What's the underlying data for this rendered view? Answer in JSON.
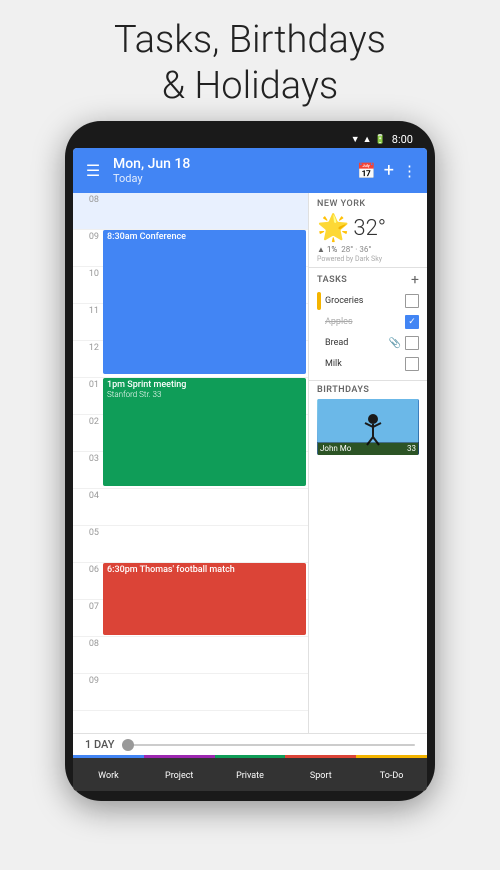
{
  "page": {
    "title_line1": "Tasks, Birthdays",
    "title_line2": "& Holidays"
  },
  "status_bar": {
    "time": "8:00"
  },
  "toolbar": {
    "date": "Mon, Jun 18",
    "subtitle": "Today",
    "menu_icon": "☰",
    "calendar_icon": "📅",
    "add_icon": "+",
    "more_icon": "⋮"
  },
  "calendar": {
    "slots": [
      {
        "hour": "08",
        "has_event": false,
        "shaded": true
      },
      {
        "hour": "09",
        "has_event": false,
        "shaded": false
      },
      {
        "hour": "10",
        "has_event": false,
        "shaded": false
      },
      {
        "hour": "11",
        "has_event": false,
        "shaded": false
      },
      {
        "hour": "12",
        "has_event": false,
        "shaded": false
      },
      {
        "hour": "01",
        "has_event": false,
        "shaded": false
      },
      {
        "hour": "02",
        "has_event": false,
        "shaded": false
      },
      {
        "hour": "03",
        "has_event": false,
        "shaded": false
      },
      {
        "hour": "04",
        "has_event": false,
        "shaded": false
      },
      {
        "hour": "05",
        "has_event": false,
        "shaded": false
      },
      {
        "hour": "06",
        "has_event": false,
        "shaded": false
      },
      {
        "hour": "07",
        "has_event": false,
        "shaded": false
      },
      {
        "hour": "08",
        "has_event": false,
        "shaded": false
      },
      {
        "hour": "09",
        "has_event": false,
        "shaded": false
      }
    ],
    "events": [
      {
        "id": "conference",
        "title": "8:30am Conference",
        "color": "blue",
        "top_slot": 0,
        "span": 4
      },
      {
        "id": "sprint",
        "title": "1pm Sprint meeting",
        "subtitle": "Stanford Str. 33",
        "color": "green",
        "top_slot": 5,
        "span": 3
      },
      {
        "id": "football",
        "title": "6:30pm Thomas' football match",
        "color": "red",
        "top_slot": 10,
        "span": 2
      }
    ]
  },
  "weather": {
    "location": "NEW YORK",
    "temp": "32°",
    "icon": "☀",
    "precip_percent": "1%",
    "range": "28° · 36°",
    "powered_by": "Powered by Dark Sky"
  },
  "tasks": {
    "title": "TASKS",
    "add_label": "+",
    "items": [
      {
        "name": "Groceries",
        "color": "#f4b400",
        "checked": false,
        "strikethrough": false
      },
      {
        "name": "Apples",
        "color": "",
        "checked": true,
        "strikethrough": true
      },
      {
        "name": "Bread",
        "color": "",
        "checked": false,
        "strikethrough": false,
        "has_icon": true
      },
      {
        "name": "Milk",
        "color": "",
        "checked": false,
        "strikethrough": false
      }
    ]
  },
  "birthdays": {
    "title": "BIRTHDAYS",
    "person_name": "John Mo",
    "person_age": "33"
  },
  "day_view": {
    "label": "1 DAY"
  },
  "bottom_tabs": [
    {
      "label": "Work",
      "color": "#4285f4"
    },
    {
      "label": "Project",
      "color": "#9c27b0"
    },
    {
      "label": "Private",
      "color": "#0f9d58"
    },
    {
      "label": "Sport",
      "color": "#db4437"
    },
    {
      "label": "To-Do",
      "color": "#f4b400"
    }
  ]
}
